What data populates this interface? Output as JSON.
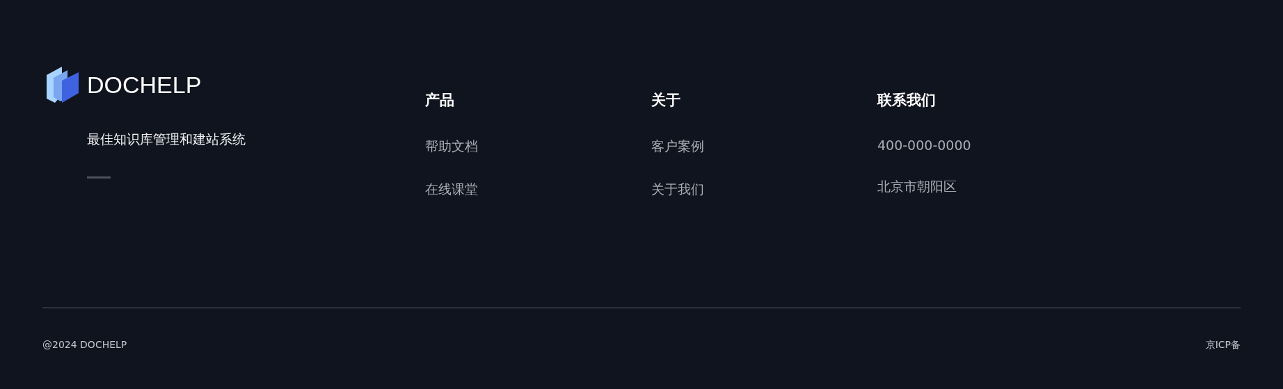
{
  "brand": {
    "name": "DOCHELP",
    "tagline": "最佳知识库管理和建站系统"
  },
  "columns": [
    {
      "title": "产品",
      "links": [
        "帮助文档",
        "在线课堂"
      ]
    },
    {
      "title": "关于",
      "links": [
        "客户案例",
        "关于我们"
      ]
    },
    {
      "title": "联系我们",
      "links": [
        "400-000-0000",
        "北京市朝阳区"
      ]
    }
  ],
  "bottom": {
    "copyright": "@2024 DOCHELP",
    "icp": "京ICP备"
  }
}
